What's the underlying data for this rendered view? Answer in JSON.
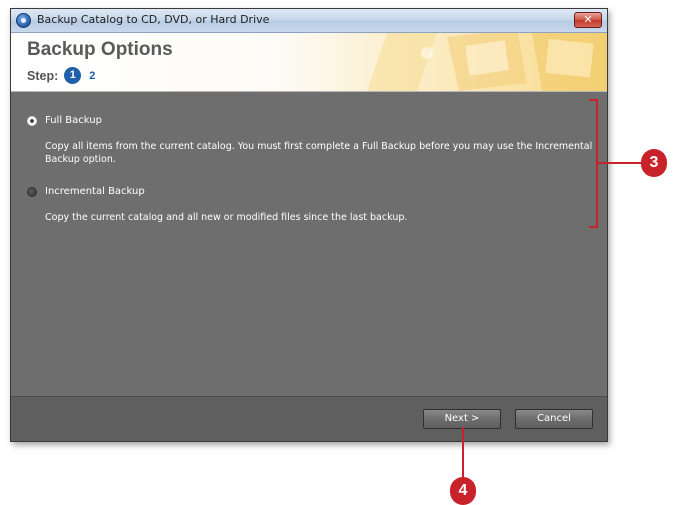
{
  "window": {
    "title": "Backup Catalog to CD, DVD, or Hard Drive",
    "close_glyph": "✕",
    "icon": "app-catalog-icon"
  },
  "header": {
    "title": "Backup Options",
    "step_label": "Step:",
    "current_step": "1",
    "next_step": "2"
  },
  "options": [
    {
      "label": "Full Backup",
      "selected": true,
      "description": "Copy all items from the current catalog. You must first complete a Full Backup before you may use the Incremental Backup option."
    },
    {
      "label": "Incremental Backup",
      "selected": false,
      "description": "Copy the current catalog and all new or modified files since the last backup."
    }
  ],
  "footer": {
    "next_label": "Next >",
    "cancel_label": "Cancel"
  },
  "callouts": {
    "options_marker": "3",
    "next_marker": "4"
  },
  "colors": {
    "callout": "#c8222a",
    "step_accent": "#1f5fa9",
    "panel": "#6e6e6e"
  }
}
